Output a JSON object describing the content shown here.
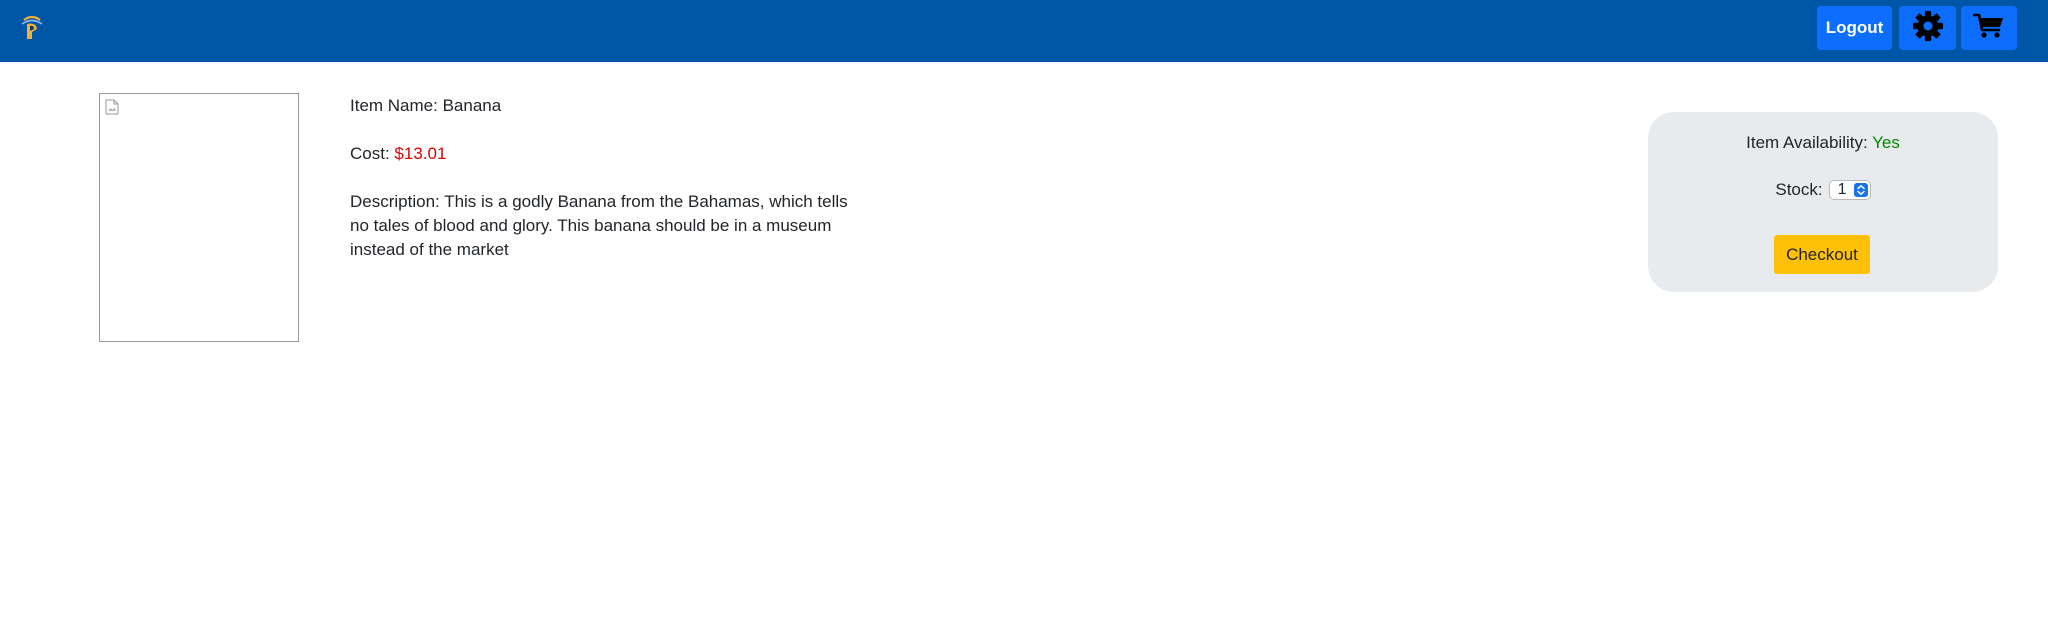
{
  "nav": {
    "logout_label": "Logout",
    "logo_icon": "spartan-helmet-logo-icon",
    "settings_icon": "gear-icon",
    "cart_icon": "shopping-cart-icon",
    "brand_color": "#0056a6",
    "button_color": "#0d6efd"
  },
  "product": {
    "image_icon": "broken-image-icon",
    "name_label": "Item Name: ",
    "name": "Banana",
    "cost_label": "Cost: ",
    "cost": "$13.01",
    "description_label": "Description: ",
    "description": "This is a godly Banana from the Bahamas, which tells no tales of blood and glory. This banana should be in a museum instead of the market"
  },
  "purchase_panel": {
    "availability_label": "Item Availability: ",
    "availability_value": "Yes",
    "stock_label": "Stock:",
    "stock_selected": "1",
    "checkout_label": "Checkout",
    "checkout_color": "#ffc107"
  }
}
